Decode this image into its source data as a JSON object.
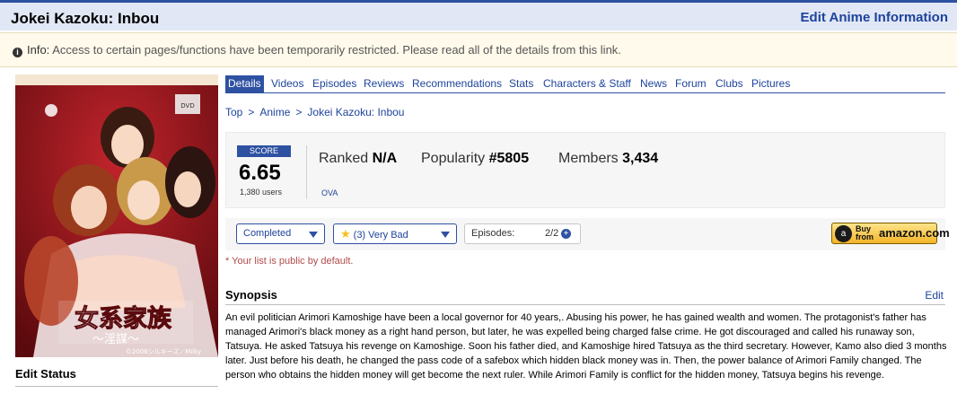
{
  "header": {
    "title": "Jokei Kazoku: Inbou",
    "edit_link": "Edit Anime Information"
  },
  "notice": {
    "label": "Info:",
    "text": "Access to certain pages/functions have been temporarily restricted. Please read all of the details from this link."
  },
  "sidebar": {
    "cover_text": {
      "logo": "女系家族",
      "sublogo": "〜淫謀〜",
      "copyright": "©2006シルキーズ／Milky",
      "dvd": "DVD"
    },
    "edit_status": "Edit Status"
  },
  "tabs": [
    {
      "label": "Details",
      "active": true
    },
    {
      "label": "Videos"
    },
    {
      "label": "Episodes"
    },
    {
      "label": "Reviews"
    },
    {
      "label": "Recommendations"
    },
    {
      "label": "Stats"
    },
    {
      "label": "Characters & Staff"
    },
    {
      "label": "News"
    },
    {
      "label": "Forum"
    },
    {
      "label": "Clubs"
    },
    {
      "label": "Pictures"
    }
  ],
  "breadcrumb": [
    "Top",
    "Anime",
    "Jokei Kazoku: Inbou"
  ],
  "breadcrumb_sep": ">",
  "stats": {
    "score_label": "SCORE",
    "score": "6.65",
    "users": "1,380 users",
    "ranked_label": "Ranked",
    "ranked_value": "N/A",
    "popularity_label": "Popularity",
    "popularity_value": "#5805",
    "members_label": "Members",
    "members_value": "3,434",
    "type": "OVA"
  },
  "list": {
    "status": "Completed",
    "rating": "(3) Very Bad",
    "episodes_label": "Episodes:",
    "episodes_value": "2/2",
    "plus": "+"
  },
  "amazon": {
    "buy": "Buy",
    "from": "from",
    "brand": "amazon.com"
  },
  "public_note": "* Your list is public by default.",
  "synopsis": {
    "heading": "Synopsis",
    "edit": "Edit",
    "text": "An evil politician Arimori Kamoshige have been a local governor for 40 years,. Abusing his power, he has gained wealth and women. The protagonist's father has managed Arimori's black money as a right hand person, but later, he was expelled being charged false crime. He got discouraged and called his runaway son, Tatsuya. He asked Tatsuya his revenge on Kamoshige. Soon his father died, and Kamoshige hired Tatsuya as the third secretary. However, Kamo also died 3 months later. Just before his death, he changed the pass code of a safebox which hidden black money was in. Then, the power balance of Arimori Family changed. The person who obtains the hidden money will get become the next ruler. While Arimori Family is conflict for the hidden money, Tatsuya begins his revenge."
  },
  "colors": {
    "brand": "#2e51a2",
    "link": "#1d439b",
    "header_bg": "#e1e7f5",
    "notice_bg": "#fffaeb"
  }
}
